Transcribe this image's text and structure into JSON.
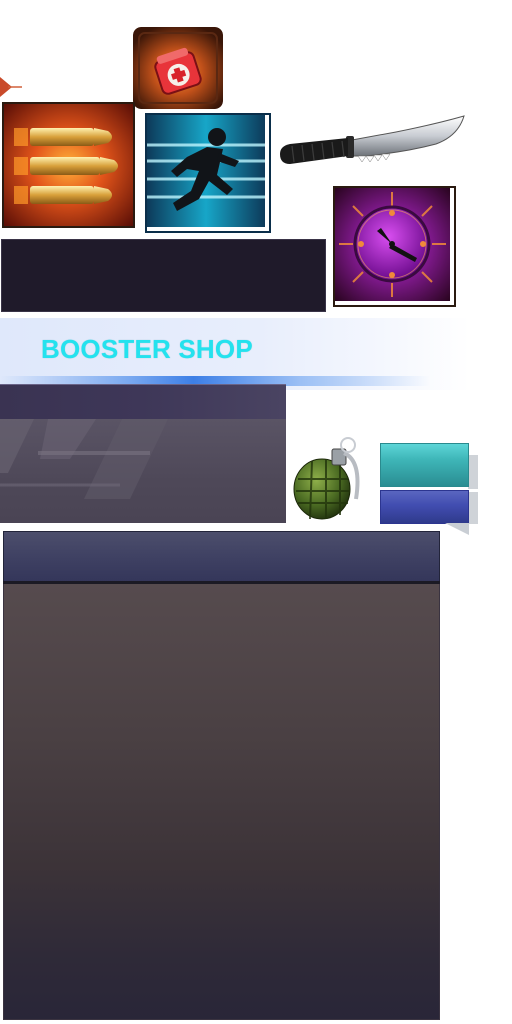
{
  "banner": {
    "title": "BOOSTER SHOP"
  },
  "icons": {
    "medkit": "medkit-icon",
    "ammo": "ammo-icon",
    "sprint": "sprint-icon",
    "knife": "knife-icon",
    "clock": "clock-icon",
    "grenade": "grenade-icon"
  },
  "colors": {
    "banner_title": "#24e2ee",
    "teal_button": "#3fb7b9",
    "blue_button": "#414db0",
    "panel_dark": "#1f1a2a"
  }
}
